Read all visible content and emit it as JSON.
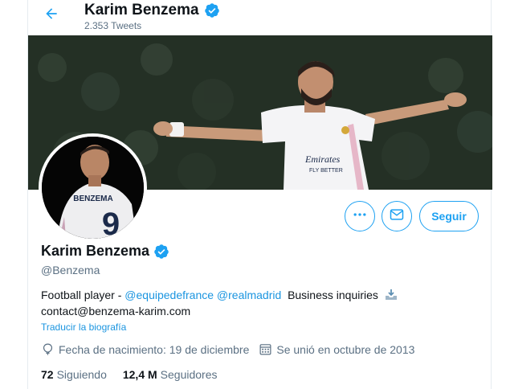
{
  "header": {
    "name": "Karim Benzema",
    "tweets_count": "2.353 Tweets"
  },
  "profile": {
    "name": "Karim Benzema",
    "handle": "@Benzema",
    "follow_label": "Seguir",
    "bio": {
      "prefix": "Football player - ",
      "mention_1": "@equipedefrance",
      "mention_2": "@realmadrid",
      "suffix": "Business inquiries",
      "email": "contact@benzema-karim.com"
    },
    "translate_label": "Traducir la biografía",
    "birthdate": "Fecha de nacimiento: 19 de diciembre",
    "joined": "Se unió en octubre de 2013",
    "following_count": "72",
    "following_label": "Siguiendo",
    "followers_count": "12,4 M",
    "followers_label": "Seguidores",
    "avatar_jersey_text": "BENZEMA",
    "avatar_jersey_number": "9"
  },
  "banner": {
    "jersey_text": "Emirates FLY BETTER"
  },
  "icons": {
    "back": "arrow-left-icon",
    "verified": "verified-badge-icon",
    "more": "more-horizontal-icon",
    "message": "envelope-icon",
    "inbox": "inbox-tray-icon",
    "birthday": "balloon-icon",
    "calendar": "calendar-icon"
  },
  "colors": {
    "accent": "#1da1f2",
    "link": "#1b95e0",
    "muted": "#5b7083",
    "text": "#0f1419"
  }
}
